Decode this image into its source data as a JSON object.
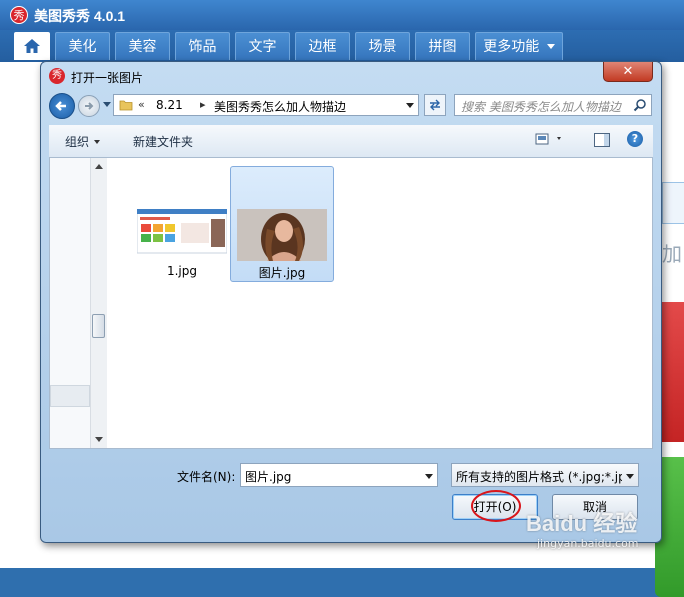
{
  "app": {
    "logo_char": "秀",
    "title": "美图秀秀 4.0.1",
    "tabs": [
      "美化",
      "美容",
      "饰品",
      "文字",
      "边框",
      "场景",
      "拼图",
      "更多功能"
    ]
  },
  "dialog": {
    "icon_char": "秀",
    "title": "打开一张图片",
    "close_label": "✕",
    "breadcrumb": {
      "overflow": "«",
      "items": [
        "8.21",
        "美图秀秀怎么加人物描边"
      ]
    },
    "search_placeholder": "搜索 美图秀秀怎么加人物描边",
    "toolbar": {
      "organize": "组织",
      "new_folder": "新建文件夹"
    },
    "files": [
      {
        "name": "1.jpg",
        "selected": false
      },
      {
        "name": "图片.jpg",
        "selected": true
      }
    ],
    "filename_label": "文件名(N):",
    "filename_value": "图片.jpg",
    "filetype_value": "所有支持的图片格式 (*.jpg;*.jp",
    "open_button": "打开(O)",
    "cancel_button": "取消"
  },
  "watermark": {
    "brand": "Baidu 经验",
    "url": "jingyan.baidu.com"
  },
  "colors": {
    "accent_blue": "#2a66ad",
    "highlight_red": "#d9151b"
  }
}
